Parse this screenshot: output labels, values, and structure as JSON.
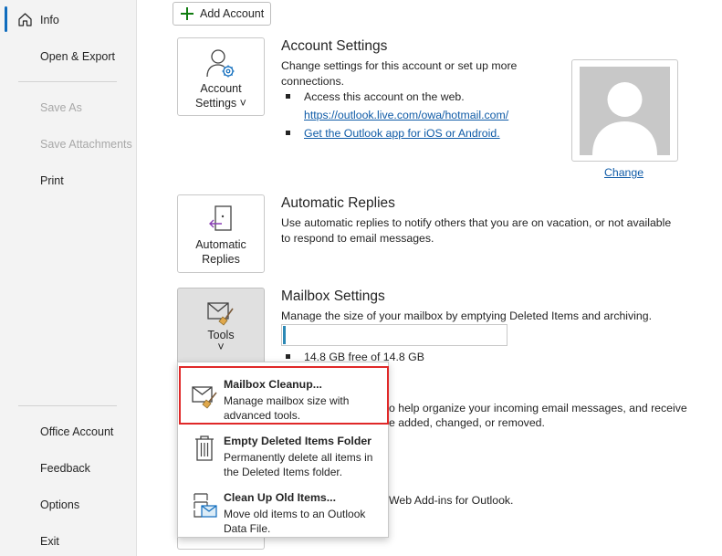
{
  "sidebar": {
    "items": [
      {
        "label": "Info",
        "state": "active"
      },
      {
        "label": "Open & Export",
        "state": "normal"
      },
      {
        "label": "Save As",
        "state": "disabled"
      },
      {
        "label": "Save Attachments",
        "state": "disabled"
      },
      {
        "label": "Print",
        "state": "normal"
      },
      {
        "label": "Office Account",
        "state": "normal"
      },
      {
        "label": "Feedback",
        "state": "normal"
      },
      {
        "label": "Options",
        "state": "normal"
      },
      {
        "label": "Exit",
        "state": "normal"
      }
    ],
    "home_icon": "home-icon"
  },
  "add_account": {
    "label": "Add Account",
    "icon": "plus-icon"
  },
  "account_settings": {
    "tile_line1": "Account",
    "tile_line2": "Settings ˅",
    "title": "Account Settings",
    "desc": "Change settings for this account or set up more connections.",
    "bullet1": "Access this account on the web.",
    "bullet1_link": "https://outlook.live.com/owa/hotmail.com/",
    "bullet2_link": "Get the Outlook app for iOS or Android.",
    "photo_action": "Change"
  },
  "automatic_replies": {
    "tile_line1": "Automatic",
    "tile_line2": "Replies",
    "title": "Automatic Replies",
    "desc": "Use automatic replies to notify others that you are on vacation, or not available to respond to email messages."
  },
  "mailbox_settings": {
    "tile_label": "Tools",
    "tile_chevron": "˅",
    "title": "Mailbox Settings",
    "desc": "Manage the size of your mailbox by emptying Deleted Items and archiving.",
    "quota_text": "14.8 GB free of 14.8 GB",
    "quota_used_fraction": 0.01
  },
  "partially_hidden": {
    "rules_desc_line1": "o help organize your incoming email messages, and receive",
    "rules_desc_line2": "e added, changed, or removed.",
    "addins_desc": "Web Add-ins for Outlook."
  },
  "tools_menu": {
    "items": [
      {
        "title": "Mailbox Cleanup...",
        "desc": "Manage mailbox size with advanced tools.",
        "icon": "mailbox-cleanup-icon",
        "highlighted": true
      },
      {
        "title": "Empty Deleted Items Folder",
        "desc": "Permanently delete all items in the Deleted Items folder.",
        "icon": "trash-icon",
        "highlighted": false
      },
      {
        "title": "Clean Up Old Items...",
        "desc": "Move old items to an Outlook Data File.",
        "icon": "archive-icon",
        "highlighted": false
      }
    ]
  },
  "colors": {
    "accent": "#0f6cbd",
    "link": "#0f5ba7",
    "highlight_border": "#e02828",
    "quota_fill": "#2b88b5"
  }
}
